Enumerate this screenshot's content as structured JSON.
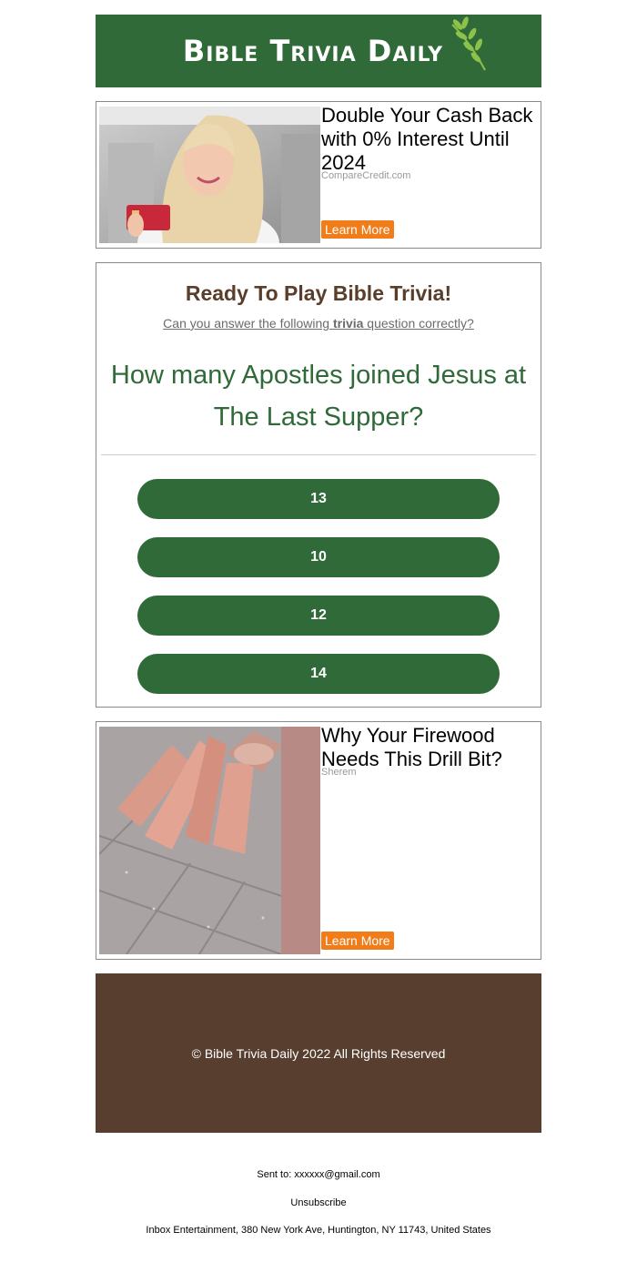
{
  "header": {
    "logo_text": "Bible Trivia Daily",
    "brand_color": "#2f6a38"
  },
  "ad1": {
    "title": "Double Your Cash Back with 0% Interest Until 2024",
    "source": "CompareCredit.com",
    "cta": "Learn More"
  },
  "trivia": {
    "heading": "Ready To Play Bible Trivia!",
    "sub_before": "Can you answer the following ",
    "sub_bold": "trivia",
    "sub_after": " question correctly?",
    "question": "How many Apostles joined Jesus at The Last Supper?",
    "answers": [
      "13",
      "10",
      "12",
      "14"
    ]
  },
  "ad2": {
    "title": "Why Your Firewood Needs This Drill Bit?",
    "source": "Sherem",
    "cta": "Learn More"
  },
  "footer": {
    "copyright": "© Bible Trivia Daily 2022 All Rights Reserved",
    "bg_color": "#573e2f"
  },
  "meta": {
    "sent_to_label": "Sent to: ",
    "email": "xxxxxx@gmail.com",
    "unsubscribe": "Unsubscribe",
    "address": "Inbox Entertainment, 380 New York Ave, Huntington, NY 11743, United States"
  },
  "colors": {
    "accent_orange": "#f07d1a",
    "heading_brown": "#5a3e2b"
  }
}
